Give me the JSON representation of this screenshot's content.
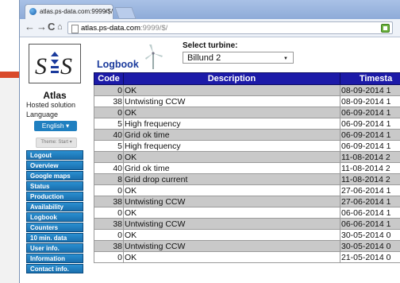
{
  "browser": {
    "tab_title": "atlas.ps-data.com:9999/$/",
    "tab_close": "×",
    "url_host": "atlas.ps-data.com",
    "url_rest": ":9999/$/"
  },
  "sidebar": {
    "brand": "Atlas",
    "hosted": "Hosted solution",
    "language_label": "Language",
    "language_value": "English",
    "theme_value": "Theme: Start",
    "menu": [
      "Logout",
      "Overview",
      "Google maps",
      "Status",
      "Production",
      "Availability",
      "Logbook",
      "Counters",
      "10 min. data",
      "User info.",
      "Information",
      "Contact info."
    ]
  },
  "main": {
    "title": "Logbook",
    "select_label": "Select turbine:",
    "select_value": "Billund 2"
  },
  "table": {
    "headers": [
      "Code",
      "Description",
      "Timesta"
    ],
    "rows": [
      {
        "code": "0",
        "desc": "OK",
        "time": "08-09-2014 1"
      },
      {
        "code": "38",
        "desc": "Untwisting CCW",
        "time": "08-09-2014 1"
      },
      {
        "code": "0",
        "desc": "OK",
        "time": "06-09-2014 1"
      },
      {
        "code": "5",
        "desc": "High frequency",
        "time": "06-09-2014 1"
      },
      {
        "code": "40",
        "desc": "Grid ok time",
        "time": "06-09-2014 1"
      },
      {
        "code": "5",
        "desc": "High frequency",
        "time": "06-09-2014 1"
      },
      {
        "code": "0",
        "desc": "OK",
        "time": "11-08-2014 2"
      },
      {
        "code": "40",
        "desc": "Grid ok time",
        "time": "11-08-2014 2"
      },
      {
        "code": "8",
        "desc": "Grid drop current",
        "time": "11-08-2014 2"
      },
      {
        "code": "0",
        "desc": "OK",
        "time": "27-06-2014 1"
      },
      {
        "code": "38",
        "desc": "Untwisting CCW",
        "time": "27-06-2014 1"
      },
      {
        "code": "0",
        "desc": "OK",
        "time": "06-06-2014 1"
      },
      {
        "code": "38",
        "desc": "Untwisting CCW",
        "time": "06-06-2014 1"
      },
      {
        "code": "0",
        "desc": "OK",
        "time": "30-05-2014 0"
      },
      {
        "code": "38",
        "desc": "Untwisting CCW",
        "time": "30-05-2014 0"
      },
      {
        "code": "0",
        "desc": "OK",
        "time": "21-05-2014 0"
      }
    ]
  },
  "colors": {
    "header_bg": "#1c1aa8",
    "row_gray": "#c9c9c9",
    "menu_blue": "#1a6fae",
    "title_blue": "#1a3a9c"
  }
}
